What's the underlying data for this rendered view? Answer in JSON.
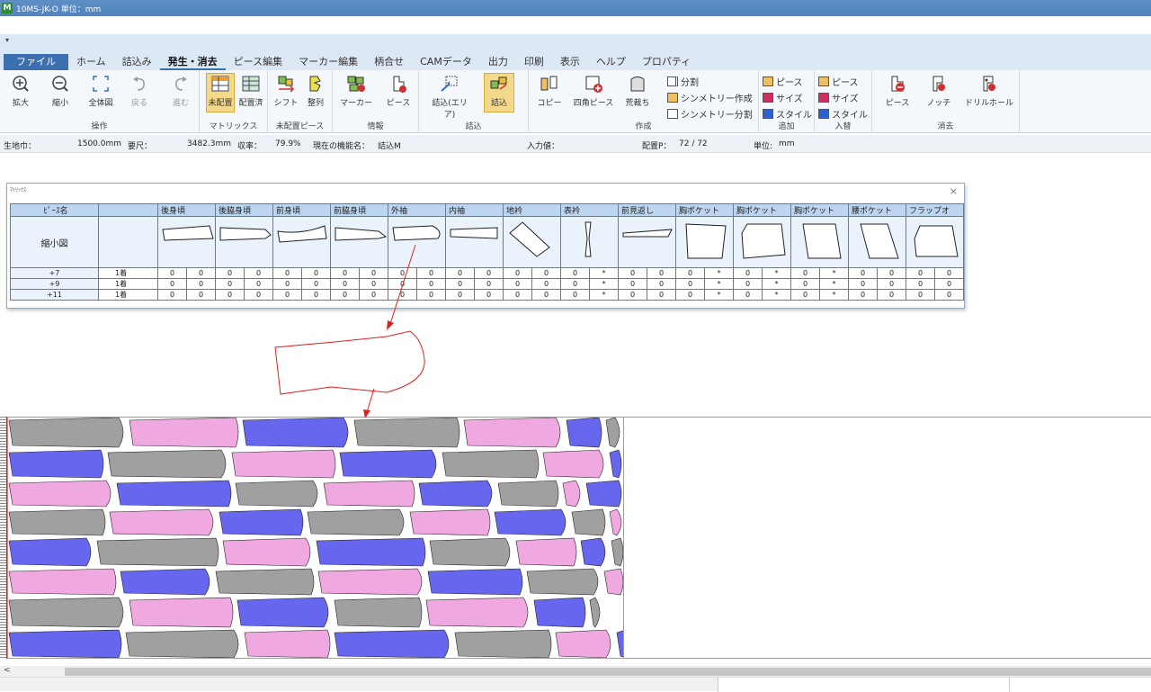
{
  "window": {
    "title": "10MS-JK-O 単位：mm",
    "app_icon": "M"
  },
  "qat": {
    "arrow": "▾"
  },
  "tabs": [
    "ファイル",
    "ホーム",
    "詰込み",
    "発生・消去",
    "ピース編集",
    "マーカー編集",
    "柄合せ",
    "CAMデータ",
    "出力",
    "印刷",
    "表示",
    "ヘルプ",
    "プロパティ"
  ],
  "active_tab": "発生・消去",
  "ribbon": {
    "ops": {
      "label": "操作",
      "zoom_in": "拡大",
      "zoom_out": "縮小",
      "fit": "全体図",
      "undo": "戻る",
      "redo": "進む"
    },
    "matrix": {
      "label": "マトリックス",
      "unplaced": "未配置",
      "placed": "配置済"
    },
    "unplaced_piece": {
      "label": "未配置ピース",
      "shift": "シフト",
      "align": "整列"
    },
    "info": {
      "label": "情報",
      "marker": "マーカー",
      "piece": "ピース"
    },
    "pack": {
      "label": "詰込",
      "area": "詰込(エリア)",
      "pack": "詰込"
    },
    "create": {
      "label": "作成",
      "copy": "コピー",
      "rect_piece": "四角ピース",
      "rough": "荒裁ち",
      "split": "分割",
      "sym_create": "シンメトリー作成",
      "sym_split": "シンメトリー分割"
    },
    "add": {
      "label": "追加",
      "piece": "ピース",
      "size": "サイズ",
      "style": "スタイル"
    },
    "swap": {
      "label": "入替",
      "piece": "ピース",
      "size": "サイズ",
      "style": "スタイル"
    },
    "erase": {
      "label": "消去",
      "piece": "ピース",
      "notch": "ノッチ",
      "drill": "ドリルホール"
    }
  },
  "status": {
    "fabric_width_label": "生地巾：",
    "fabric_width": "1500.0mm",
    "length_label": "要尺：",
    "length": "3482.3mm",
    "yield_label": "収率：",
    "yield": "79.9%",
    "function_label": "現在の機能名：",
    "function": "詰込M",
    "input_label": "入力値：",
    "placed_label": "配置P：",
    "placed": "72 / 72",
    "unit_label": "単位:",
    "unit": "mm"
  },
  "matrix_window": {
    "title": "ﾏﾄﾘｯｸｽ",
    "close": "×",
    "header_name": "ﾋﾟｰｽ名",
    "thumb_label": "縮小図",
    "pieces": [
      "後身頃",
      "後脇身頃",
      "前身頃",
      "前脇身頃",
      "外袖",
      "内袖",
      "地衿",
      "表衿",
      "前見返し",
      "胸ポケット",
      "胸ポケット",
      "胸ポケット",
      "腰ポケット",
      "フラップオ"
    ],
    "rows": [
      {
        "size": "+7",
        "qty": "1着",
        "cells": [
          "0",
          "0",
          "0",
          "0",
          "0",
          "0",
          "0",
          "0",
          "0",
          "0",
          "0",
          "0",
          "0",
          "0",
          "0",
          "*",
          "0",
          "0",
          "0",
          "*",
          "0",
          "*",
          "0",
          "*",
          "0",
          "0",
          "0",
          "0"
        ]
      },
      {
        "size": "+9",
        "qty": "1着",
        "cells": [
          "0",
          "0",
          "0",
          "0",
          "0",
          "0",
          "0",
          "0",
          "0",
          "0",
          "0",
          "0",
          "0",
          "0",
          "0",
          "*",
          "0",
          "0",
          "0",
          "*",
          "0",
          "*",
          "0",
          "*",
          "0",
          "0",
          "0",
          "0"
        ]
      },
      {
        "size": "+11",
        "qty": "1着",
        "cells": [
          "0",
          "0",
          "0",
          "0",
          "0",
          "0",
          "0",
          "0",
          "0",
          "0",
          "0",
          "0",
          "0",
          "0",
          "0",
          "*",
          "0",
          "0",
          "0",
          "*",
          "0",
          "*",
          "0",
          "*",
          "0",
          "0",
          "0",
          "0"
        ]
      }
    ]
  },
  "scroll": {
    "left_arrow": "<"
  },
  "colors": {
    "gray": "#a0a0a0",
    "pink": "#f0a8e0",
    "blue": "#6666ee",
    "accent": "#3b6fb0",
    "annotation": "#e02020"
  }
}
